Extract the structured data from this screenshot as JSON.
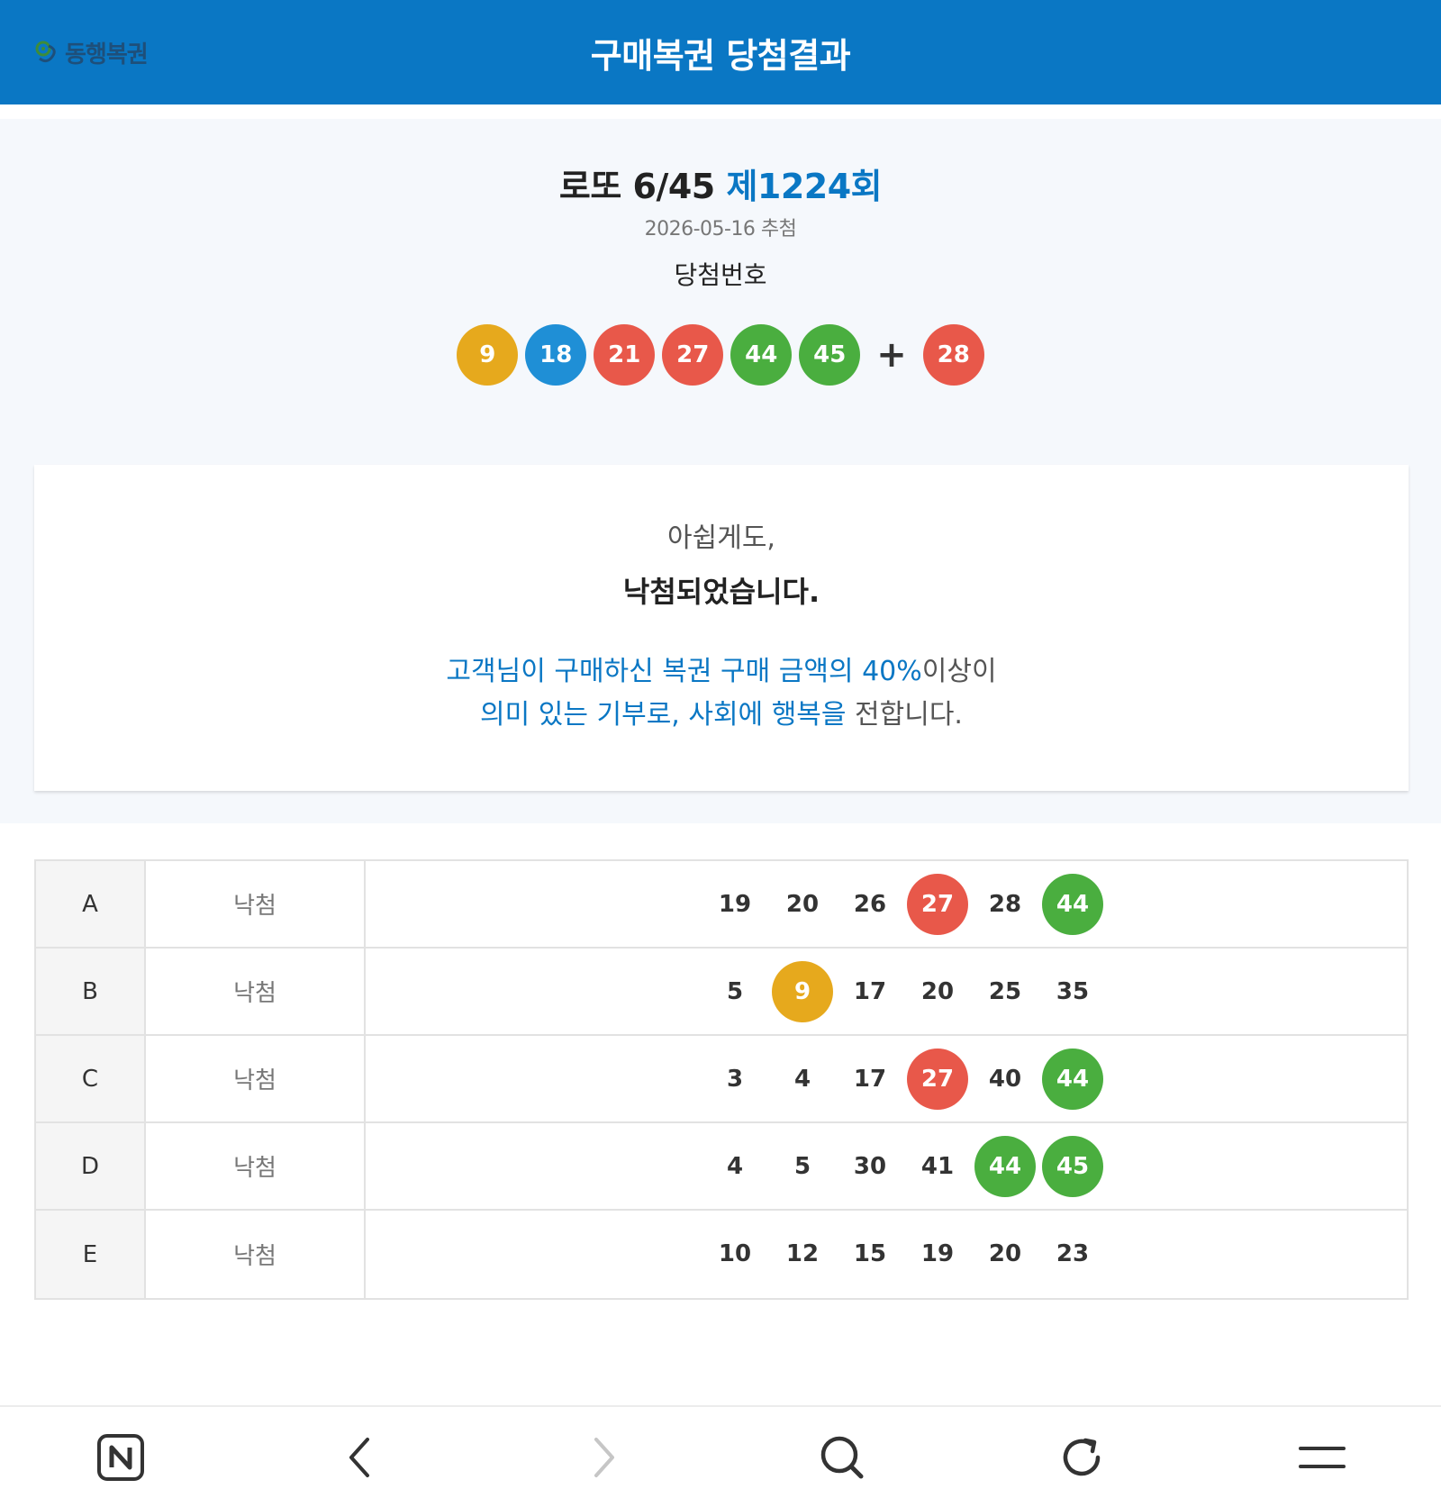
{
  "header": {
    "logo_text": "동행복권",
    "title": "구매복권 당첨결과"
  },
  "summary": {
    "game_name": "로또 6/45",
    "round": "제1224회",
    "draw_date": "2026-05-16 추첨",
    "winning_label": "당첨번호",
    "plus_sign": "+",
    "winning_numbers": [
      {
        "value": "9",
        "color": "#e6a91d"
      },
      {
        "value": "18",
        "color": "#1f8fd6"
      },
      {
        "value": "21",
        "color": "#e8584a"
      },
      {
        "value": "27",
        "color": "#e8584a"
      },
      {
        "value": "44",
        "color": "#4aae3f"
      },
      {
        "value": "45",
        "color": "#4aae3f"
      }
    ],
    "bonus_number": {
      "value": "28",
      "color": "#e8584a"
    }
  },
  "result": {
    "line1": "아쉽게도,",
    "line2": "낙첨되었습니다.",
    "donation_part1": "고객님이 구매하신 복권 구매 금액의 40%",
    "donation_part2": "이상이",
    "donation_part3": "의미 있는 기부로, 사회에 행복을",
    "donation_part4": " 전합니다."
  },
  "tickets": [
    {
      "label": "A",
      "status": "낙첨",
      "numbers": [
        {
          "value": "19",
          "color": ""
        },
        {
          "value": "20",
          "color": ""
        },
        {
          "value": "26",
          "color": ""
        },
        {
          "value": "27",
          "color": "#e8584a"
        },
        {
          "value": "28",
          "color": ""
        },
        {
          "value": "44",
          "color": "#4aae3f"
        }
      ]
    },
    {
      "label": "B",
      "status": "낙첨",
      "numbers": [
        {
          "value": "5",
          "color": ""
        },
        {
          "value": "9",
          "color": "#e6a91d"
        },
        {
          "value": "17",
          "color": ""
        },
        {
          "value": "20",
          "color": ""
        },
        {
          "value": "25",
          "color": ""
        },
        {
          "value": "35",
          "color": ""
        }
      ]
    },
    {
      "label": "C",
      "status": "낙첨",
      "numbers": [
        {
          "value": "3",
          "color": ""
        },
        {
          "value": "4",
          "color": ""
        },
        {
          "value": "17",
          "color": ""
        },
        {
          "value": "27",
          "color": "#e8584a"
        },
        {
          "value": "40",
          "color": ""
        },
        {
          "value": "44",
          "color": "#4aae3f"
        }
      ]
    },
    {
      "label": "D",
      "status": "낙첨",
      "numbers": [
        {
          "value": "4",
          "color": ""
        },
        {
          "value": "5",
          "color": ""
        },
        {
          "value": "30",
          "color": ""
        },
        {
          "value": "41",
          "color": ""
        },
        {
          "value": "44",
          "color": "#4aae3f"
        },
        {
          "value": "45",
          "color": "#4aae3f"
        }
      ]
    },
    {
      "label": "E",
      "status": "낙첨",
      "numbers": [
        {
          "value": "10",
          "color": ""
        },
        {
          "value": "12",
          "color": ""
        },
        {
          "value": "15",
          "color": ""
        },
        {
          "value": "19",
          "color": ""
        },
        {
          "value": "20",
          "color": ""
        },
        {
          "value": "23",
          "color": ""
        }
      ]
    }
  ],
  "bottom_nav": {
    "icons": [
      "naver-home-icon",
      "back-icon",
      "forward-icon",
      "search-icon",
      "refresh-icon",
      "menu-icon"
    ]
  }
}
